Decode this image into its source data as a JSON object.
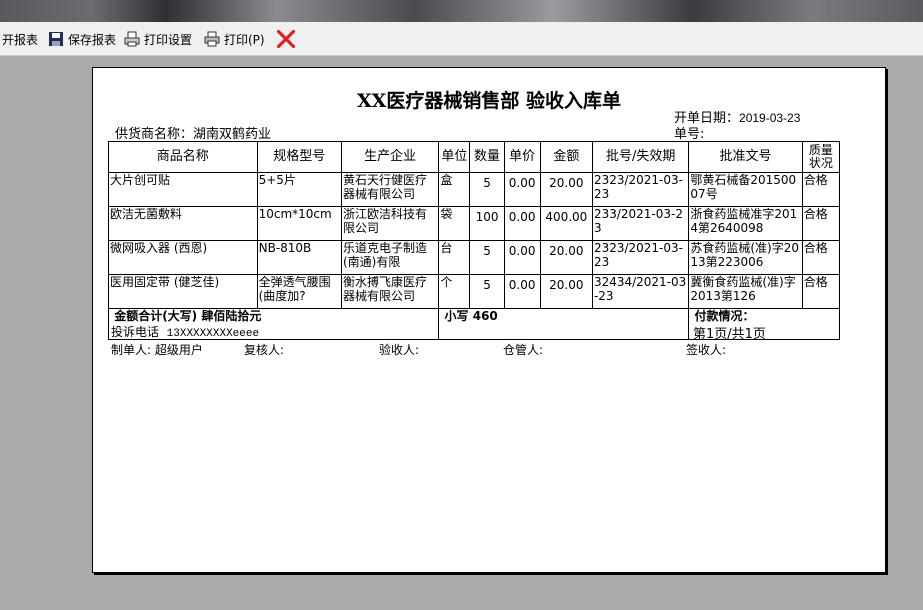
{
  "toolbar": {
    "items": [
      {
        "label": "开报表"
      },
      {
        "label": "保存报表"
      },
      {
        "label": "打印设置"
      },
      {
        "label": "打印(P)"
      }
    ]
  },
  "document": {
    "title": "XX医疗器械销售部  验收入库单",
    "open_date_label": "开单日期：",
    "open_date": "2019-03-23",
    "supplier_label": "供货商名称：",
    "supplier": "湖南双鹤药业",
    "order_no_label": "单号:",
    "order_no": ""
  },
  "table": {
    "headers": [
      "商品名称",
      "规格型号",
      "生产企业",
      "单位",
      "数量",
      "单价",
      "金额",
      "批号/失效期",
      "批准文号",
      "质量状况"
    ],
    "rows": [
      [
        "大片创可贴",
        "5+5片",
        "黄石天行健医疗器械有限公司",
        "盒",
        "5",
        "0.00",
        "20.00",
        "2323/2021-03-23",
        "鄂黄石械备20150007号",
        "合格"
      ],
      [
        "欧洁无菌敷料",
        "10cm*10cm",
        "浙江欧洁科技有限公司",
        "袋",
        "100",
        "0.00",
        "400.00",
        "233/2021-03-23",
        "浙食药监械准字2014第2640098",
        "合格"
      ],
      [
        "微网吸入器 (西恩)",
        "NB-810B",
        "乐道克电子制造(南通)有限",
        "台",
        "5",
        "0.00",
        "20.00",
        "2323/2021-03-23",
        "苏食药监械(准)字2013第223006",
        "合格"
      ],
      [
        "医用固定带 (健芝佳)",
        "全弹透气腰围(曲度加?",
        "衡水搏飞康医疗器械有限公司",
        "个",
        "5",
        "0.00",
        "20.00",
        "32434/2021-03-23",
        "冀衡食药监械(准)字2013第126",
        "合格"
      ]
    ],
    "total_upper_label": "金额合计(大写)",
    "total_upper": "肆佰陆拾元",
    "total_lower_label": "小写",
    "total_lower": "460",
    "payment_label": "付款情况："
  },
  "footer": {
    "complaint_label": "投诉电话",
    "complaint_phone": "13XXXXXXXXeeee",
    "page_info": "第1页/共1页",
    "maker_label": "制单人:",
    "maker": "超级用户",
    "reviewer_label": "复核人:",
    "receiver_label": "验收人:",
    "keeper_label": "仓管人:",
    "signer_label": "签收人:"
  }
}
